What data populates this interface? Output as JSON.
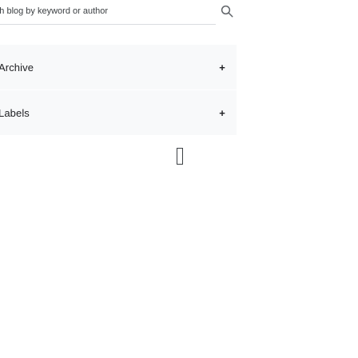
{
  "search": {
    "placeholder": "arch blog by keyword or author"
  },
  "sections": [
    {
      "title": "Archive",
      "expand_symbol": "+"
    },
    {
      "title": "Labels",
      "expand_symbol": "+"
    }
  ],
  "colors": {
    "panel_background": "#f8f9fa",
    "text": "#202124",
    "underline": "#dadce0"
  },
  "icons": {
    "search": "search-icon",
    "expand": "plus-icon"
  }
}
